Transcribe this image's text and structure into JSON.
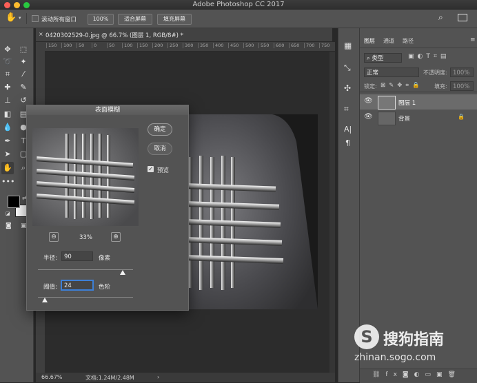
{
  "app_title": "Adobe Photoshop CC 2017",
  "options_bar": {
    "scroll_all_windows": "滚动所有窗口",
    "zoom_100": "100%",
    "fit_screen": "适合屏幕",
    "fill_screen": "填充屏幕"
  },
  "document": {
    "tab_title": "0420302529-0.jpg @ 66.7% (图层 1, RGB/8#) *",
    "ruler_ticks": [
      "150",
      "100",
      "50",
      "0",
      "50",
      "100",
      "150",
      "200",
      "250",
      "300",
      "350",
      "400",
      "450",
      "500",
      "550",
      "600",
      "650",
      "700",
      "750"
    ],
    "zoom_status": "66.67%",
    "doc_status": "文档:1.24M/2.48M"
  },
  "dialog": {
    "title": "表面模糊",
    "ok_label": "确定",
    "cancel_label": "取消",
    "preview_label": "预览",
    "preview_checked": true,
    "zoom_percent": "33%",
    "radius_label": "半径:",
    "radius_value": "90",
    "radius_unit": "像素",
    "radius_slider_fraction": 0.89,
    "threshold_label": "阈值:",
    "threshold_value": "24",
    "threshold_unit": "色阶",
    "threshold_slider_fraction": 0.07
  },
  "layers_panel": {
    "tabs": [
      "图层",
      "通道",
      "路径"
    ],
    "kind_filter": "类型",
    "blend_mode": "正常",
    "opacity_label": "不透明度:",
    "opacity_value": "100%",
    "lock_label": "锁定:",
    "fill_label": "填充:",
    "fill_value": "100%",
    "layers": [
      {
        "name": "图层 1",
        "selected": true,
        "locked": false
      },
      {
        "name": "背景",
        "selected": false,
        "locked": true
      }
    ]
  },
  "watermark": {
    "brand": "搜狗指南",
    "url": "zhinan.sogo.com"
  },
  "colors": {
    "accent": "#3d7fd6",
    "panel_bg": "#535353",
    "dark_bg": "#282828"
  }
}
